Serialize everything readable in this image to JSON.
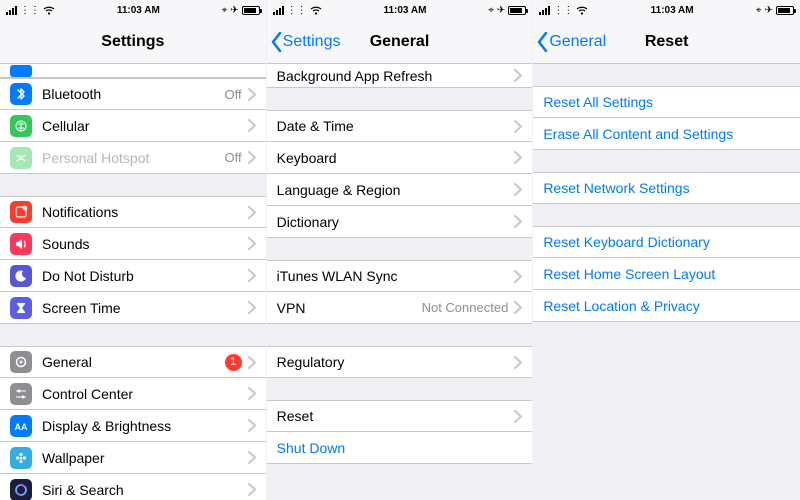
{
  "status": {
    "time": "11:03 AM",
    "carrier_glyph": "⋮⋮",
    "nav_glyph": "⌖",
    "plane_glyph": "✈"
  },
  "pane1": {
    "title": "Settings",
    "peek_icon_color": "#007aff",
    "items": [
      {
        "icon": "bluetooth",
        "color": "#007aff",
        "label": "Bluetooth",
        "value": "Off"
      },
      {
        "icon": "cellular",
        "color": "#34c759",
        "label": "Cellular",
        "value": ""
      },
      {
        "icon": "hotspot",
        "color": "#34c759",
        "label": "Personal Hotspot",
        "value": "Off",
        "dim": true
      }
    ],
    "group2": [
      {
        "icon": "notifications",
        "color": "#ff3b30",
        "label": "Notifications"
      },
      {
        "icon": "sounds",
        "color": "#ff375f",
        "label": "Sounds"
      },
      {
        "icon": "moon",
        "color": "#5856d6",
        "label": "Do Not Disturb"
      },
      {
        "icon": "hourglass",
        "color": "#5e5ce6",
        "label": "Screen Time"
      }
    ],
    "group3": [
      {
        "icon": "gear",
        "color": "#8e8e93",
        "label": "General",
        "badge": "1"
      },
      {
        "icon": "sliders",
        "color": "#8e8e93",
        "label": "Control Center"
      },
      {
        "icon": "aa",
        "color": "#007aff",
        "label": "Display & Brightness"
      },
      {
        "icon": "flower",
        "color": "#64d2ff",
        "label": "Wallpaper"
      },
      {
        "icon": "siri",
        "color": "#1d1f3a",
        "label": "Siri & Search"
      }
    ]
  },
  "pane2": {
    "back": "Settings",
    "title": "General",
    "top_row": {
      "label": "Background App Refresh"
    },
    "group1": [
      {
        "label": "Date & Time"
      },
      {
        "label": "Keyboard"
      },
      {
        "label": "Language & Region"
      },
      {
        "label": "Dictionary"
      }
    ],
    "group2": [
      {
        "label": "iTunes WLAN Sync"
      },
      {
        "label": "VPN",
        "value": "Not Connected"
      }
    ],
    "group3": [
      {
        "label": "Regulatory"
      }
    ],
    "group4": [
      {
        "label": "Reset"
      },
      {
        "label": "Shut Down",
        "link": true
      }
    ]
  },
  "pane3": {
    "back": "General",
    "title": "Reset",
    "group1": [
      {
        "label": "Reset All Settings"
      },
      {
        "label": "Erase All Content and Settings"
      }
    ],
    "group2": [
      {
        "label": "Reset Network Settings"
      }
    ],
    "group3": [
      {
        "label": "Reset Keyboard Dictionary"
      },
      {
        "label": "Reset Home Screen Layout"
      },
      {
        "label": "Reset Location & Privacy"
      }
    ]
  }
}
